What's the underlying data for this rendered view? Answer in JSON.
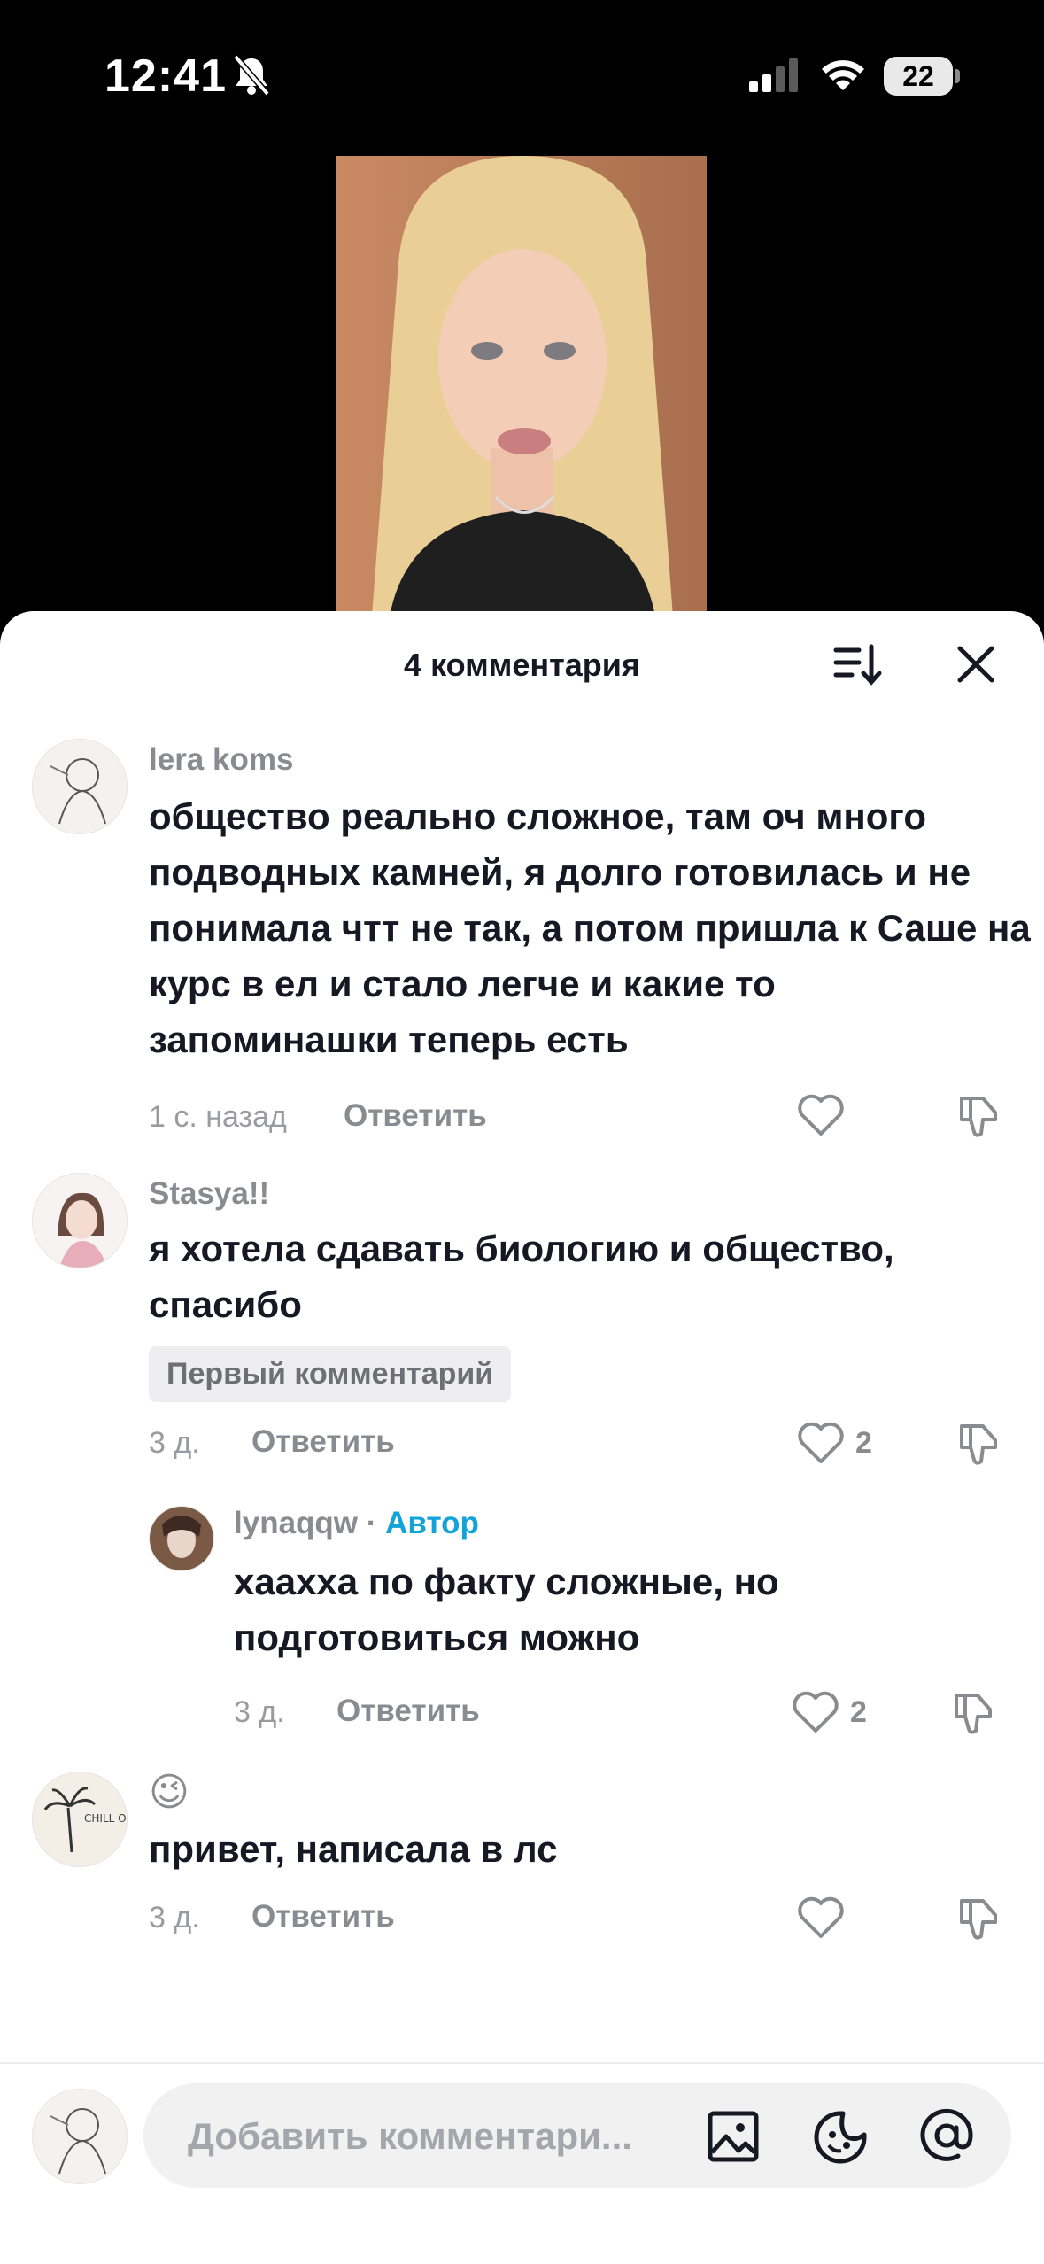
{
  "status_bar": {
    "time": "12:41",
    "battery": "22"
  },
  "sheet": {
    "title": "4 комментария"
  },
  "comments": [
    {
      "username": "lera koms",
      "text": "общество реально сложное, там оч много подводных камней, я долго готовилась и не понимала чтт не так, а потом пришла к Саше на курс в ел и стало легче и какие то запоминашки теперь есть",
      "time": "1 с. назад",
      "reply_label": "Ответить"
    },
    {
      "username": "Stasya!!",
      "text": "я хотела сдавать биологию и общество, спасибо",
      "badge": "Первый комментарий",
      "time": "3 д.",
      "reply_label": "Ответить",
      "likes": "2"
    },
    {
      "username": "lynaqqw",
      "author_tag": "Автор",
      "text": "хаахха по факту сложные, но подготовиться можно",
      "time": "3 д.",
      "reply_label": "Ответить",
      "likes": "2"
    },
    {
      "username": "😉",
      "text": "привет, написала в лс",
      "time": "3 д.",
      "reply_label": "Ответить",
      "avatar_text": "CHILL OUT"
    }
  ],
  "input": {
    "placeholder": "Добавить комментари..."
  }
}
